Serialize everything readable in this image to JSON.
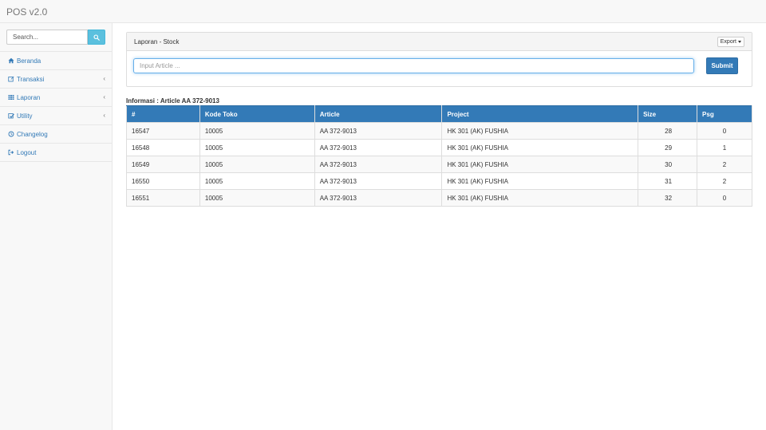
{
  "app": {
    "brand": "POS v2.0"
  },
  "sidebar": {
    "search_placeholder": "Search...",
    "items": [
      {
        "label": "Beranda",
        "icon": "home-icon",
        "has_submenu": false
      },
      {
        "label": "Transaksi",
        "icon": "edit-icon",
        "has_submenu": true
      },
      {
        "label": "Laporan",
        "icon": "table-icon",
        "has_submenu": true
      },
      {
        "label": "Utility",
        "icon": "wrench-icon",
        "has_submenu": true
      },
      {
        "label": "Changelog",
        "icon": "clock-icon",
        "has_submenu": false
      },
      {
        "label": "Logout",
        "icon": "signout-icon",
        "has_submenu": false
      }
    ]
  },
  "panel": {
    "title": "Laporan - Stock",
    "export_label": "Export",
    "input_placeholder": "Input Article ...",
    "input_value": "",
    "submit_label": "Submit"
  },
  "info": {
    "title": "Informasi : Article AA 372-9013"
  },
  "table": {
    "columns": [
      "#",
      "Kode Toko",
      "Article",
      "Project",
      "Size",
      "Psg"
    ],
    "rows": [
      [
        "16547",
        "10005",
        "AA 372-9013",
        "HK 301 (AK) FUSHIA",
        "28",
        "0"
      ],
      [
        "16548",
        "10005",
        "AA 372-9013",
        "HK 301 (AK) FUSHIA",
        "29",
        "1"
      ],
      [
        "16549",
        "10005",
        "AA 372-9013",
        "HK 301 (AK) FUSHIA",
        "30",
        "2"
      ],
      [
        "16550",
        "10005",
        "AA 372-9013",
        "HK 301 (AK) FUSHIA",
        "31",
        "2"
      ],
      [
        "16551",
        "10005",
        "AA 372-9013",
        "HK 301 (AK) FUSHIA",
        "32",
        "0"
      ]
    ]
  },
  "colors": {
    "primary": "#337ab7",
    "info": "#5bc0de",
    "danger": "#d9534f",
    "link": "#337ab7"
  }
}
